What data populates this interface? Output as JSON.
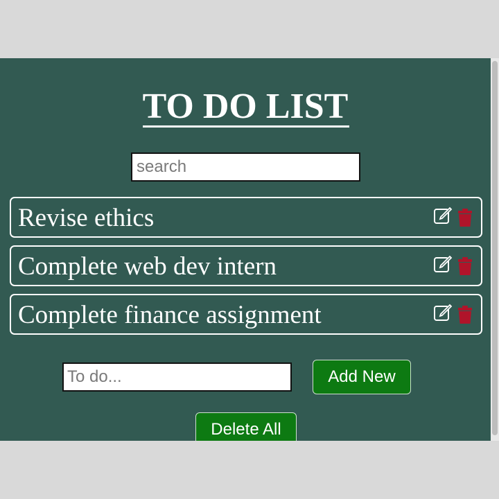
{
  "app": {
    "title": "TO DO LIST"
  },
  "search": {
    "placeholder": "search",
    "value": ""
  },
  "todos": [
    {
      "text": "Revise ethics"
    },
    {
      "text": "Complete web dev intern"
    },
    {
      "text": "Complete finance assignment"
    }
  ],
  "new_todo": {
    "placeholder": "To do...",
    "value": ""
  },
  "buttons": {
    "add_label": "Add New",
    "delete_all_label": "Delete All"
  },
  "icons": {
    "edit": "edit-icon",
    "delete": "trash-icon"
  },
  "colors": {
    "background": "#325a52",
    "button": "#0d7a12",
    "delete_icon": "#b0142a",
    "text": "#ffffff"
  }
}
